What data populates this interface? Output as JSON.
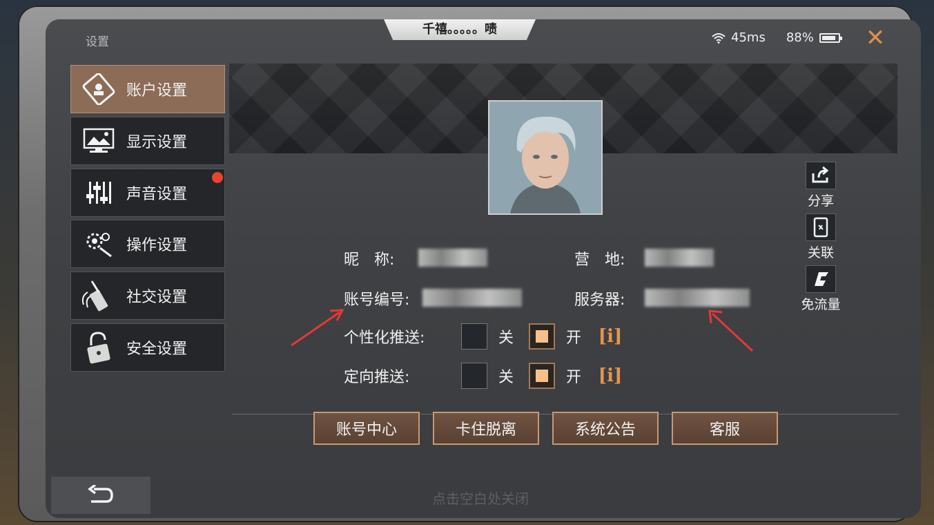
{
  "header": {
    "title": "设置",
    "banner_text": "千禧。。。。。啧",
    "ping": "45ms",
    "battery": "88%",
    "battery_level": 0.88
  },
  "sidebar": {
    "items": [
      {
        "label": "账户设置",
        "icon": "account-phone-icon",
        "active": true
      },
      {
        "label": "显示设置",
        "icon": "display-icon",
        "active": false
      },
      {
        "label": "声音设置",
        "icon": "sound-sliders-icon",
        "active": false,
        "badge": true
      },
      {
        "label": "操作设置",
        "icon": "gears-icon",
        "active": false
      },
      {
        "label": "社交设置",
        "icon": "walkie-talkie-icon",
        "active": false
      },
      {
        "label": "安全设置",
        "icon": "lock-icon",
        "active": false
      }
    ]
  },
  "profile": {
    "nickname_label": "昵　称:",
    "camp_label": "营　地:",
    "account_label": "账号编号:",
    "server_label": "服务器:"
  },
  "actions": {
    "share": "分享",
    "link": "关联",
    "free_data": "免流量"
  },
  "push": {
    "personalized_label": "个性化推送:",
    "directed_label": "定向推送:",
    "off_label": "关",
    "on_label": "开",
    "info_label": "[i]",
    "personalized_on": true,
    "directed_on": true
  },
  "buttons": {
    "account_center": "账号中心",
    "stuck_escape": "卡住脱离",
    "announcement": "系统公告",
    "support": "客服"
  },
  "hint": "点击空白处关闭",
  "colors": {
    "accent": "#e08e4a",
    "active_tab": "#8c6c57",
    "checkbox_on": "#f6c08c",
    "annotation_arrow": "#e53935"
  }
}
